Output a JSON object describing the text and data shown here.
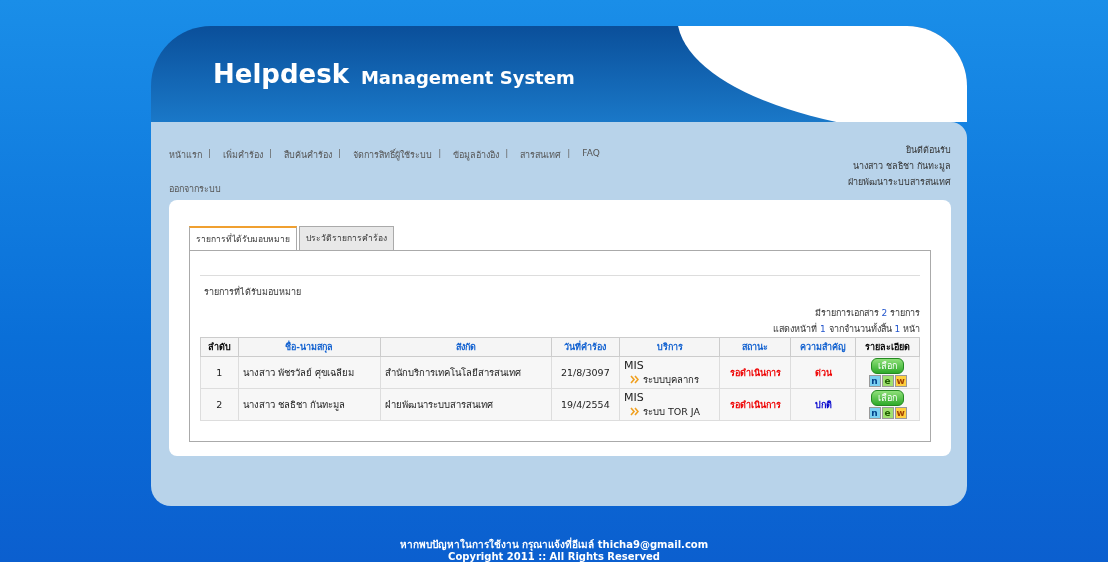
{
  "header": {
    "title": "Helpdesk",
    "subtitle": "Management System"
  },
  "nav": {
    "items": [
      "หน้าแรก",
      "เพิ่มคำร้อง",
      "สืบค้นคำร้อง",
      "จัดการสิทธิ์ผู้ใช้ระบบ",
      "ข้อมูลอ้างอิง",
      "สารสนเทศ",
      "FAQ"
    ],
    "separator": "|",
    "logout": "ออกจากระบบ"
  },
  "user": {
    "welcome": "ยินดีต้อนรับ",
    "name": "นางสาว ชลธิชา กันทะมูล",
    "department": "ฝ่ายพัฒนาระบบสารสนเทศ"
  },
  "tabs": [
    {
      "label": "รายการที่ได้รับมอบหมาย",
      "selected": true
    },
    {
      "label": "ประวัติรายการคำร้อง",
      "selected": false
    }
  ],
  "section_title": "รายการที่ได้รับมอบหมาย",
  "summary": {
    "prefix": "มีรายการเอกสาร",
    "count": "2",
    "suffix": "รายการ",
    "page_prefix": "แสดงหน้าที่",
    "page": "1",
    "page_middle": "จากจำนวนทั้งสิ้น",
    "pages": "1",
    "page_suffix": "หน้า"
  },
  "table": {
    "columns": [
      "ลำดับ",
      "ชื่อ-นามสกุล",
      "สังกัด",
      "วันที่คำร้อง",
      "บริการ",
      "สถานะ",
      "ความสำคัญ",
      "รายละเอียด"
    ],
    "rows": [
      {
        "no": "1",
        "name": "นางสาว พัชรวัลย์ ศุขเฉลียม",
        "affiliation": "สำนักบริการเทคโนโลยีสารสนเทศ",
        "date": "21/8/3097",
        "service": "MIS",
        "subservice": "ระบบบุคลากร",
        "status": "รอดำเนินการ",
        "priority": {
          "label": "ด่วน",
          "color": "#ee0000"
        },
        "button": "เลือก",
        "badge": [
          "n",
          "e",
          "w"
        ]
      },
      {
        "no": "2",
        "name": "นางสาว ชลธิชา กันทะมูล",
        "affiliation": "ฝ่ายพัฒนาระบบสารสนเทศ",
        "date": "19/4/2554",
        "service": "MIS",
        "subservice": "ระบบ TOR JA",
        "status": "รอดำเนินการ",
        "priority": {
          "label": "ปกติ",
          "color": "#0000cc"
        },
        "button": "เลือก",
        "badge": [
          "n",
          "e",
          "w"
        ]
      }
    ]
  },
  "footer": {
    "contact": "หากพบปัญหาในการใช้งาน กรุณาแจ้งที่อีเมล์ thicha9@gmail.com",
    "copyright": "Copyright 2011 :: All Rights Reserved"
  }
}
